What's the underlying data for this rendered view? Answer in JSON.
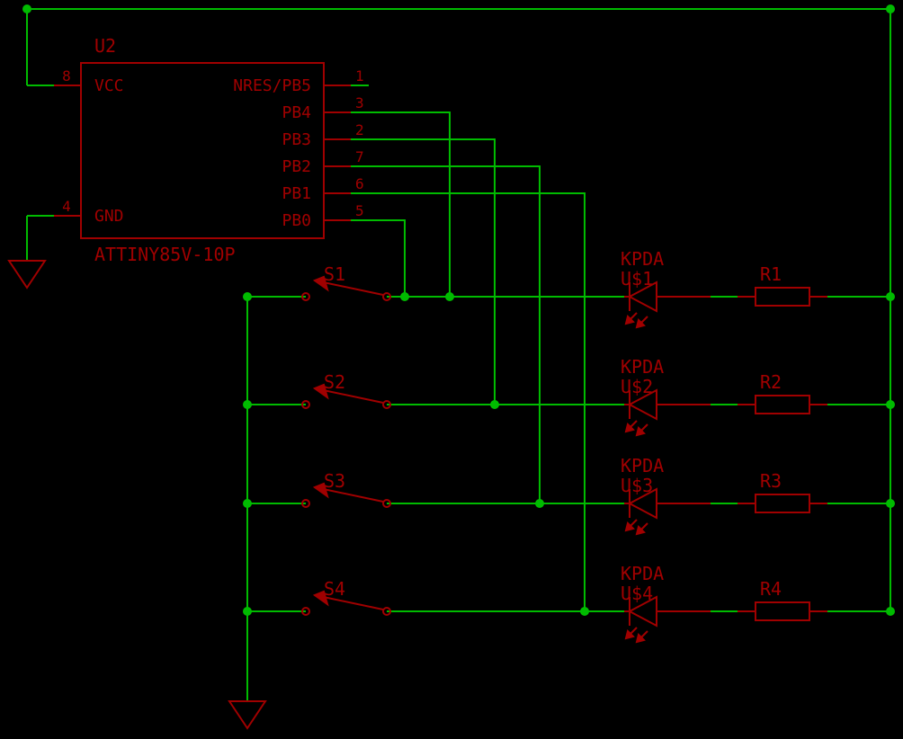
{
  "ic": {
    "ref": "U2",
    "part": "ATTINY85V-10P",
    "pins_left": [
      {
        "num": "8",
        "name": "VCC"
      },
      {
        "num": "4",
        "name": "GND"
      }
    ],
    "pins_right": [
      {
        "num": "1",
        "name": "NRES/PB5"
      },
      {
        "num": "3",
        "name": "PB4"
      },
      {
        "num": "2",
        "name": "PB3"
      },
      {
        "num": "7",
        "name": "PB2"
      },
      {
        "num": "6",
        "name": "PB1"
      },
      {
        "num": "5",
        "name": "PB0"
      }
    ]
  },
  "switches": [
    {
      "ref": "S1"
    },
    {
      "ref": "S2"
    },
    {
      "ref": "S3"
    },
    {
      "ref": "S4"
    }
  ],
  "leds": [
    {
      "type": "KPDA",
      "ref": "U$1"
    },
    {
      "type": "KPDA",
      "ref": "U$2"
    },
    {
      "type": "KPDA",
      "ref": "U$3"
    },
    {
      "type": "KPDA",
      "ref": "U$4"
    }
  ],
  "resistors": [
    {
      "ref": "R1"
    },
    {
      "ref": "R2"
    },
    {
      "ref": "R3"
    },
    {
      "ref": "R4"
    }
  ]
}
